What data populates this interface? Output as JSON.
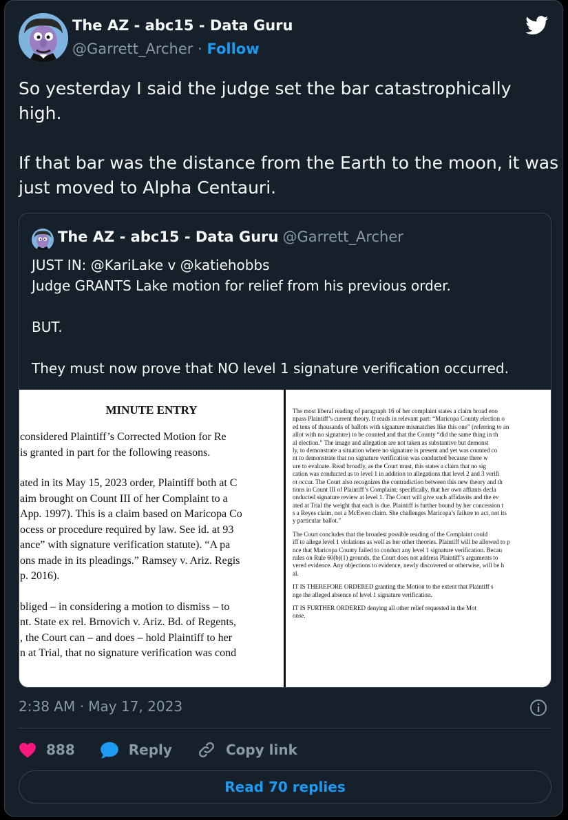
{
  "tweet": {
    "author_name": "The AZ - abc15 - Data Guru",
    "author_handle": "@Garrett_Archer",
    "separator": " · ",
    "follow_label": "Follow",
    "text": "So yesterday I said the judge set the bar catastrophically high.\n\nIf that bar was the distance from the Earth to the moon, it was just moved to Alpha Centauri.",
    "timestamp": "2:38 AM · May 17, 2023",
    "likes": "888",
    "reply_label": "Reply",
    "copy_link_label": "Copy link",
    "read_replies_label": "Read 70 replies"
  },
  "quoted": {
    "author_name": "The AZ - abc15 - Data Guru",
    "author_handle": "@Garrett_Archer",
    "text": "JUST IN: @KariLake v @katiehobbs\nJudge GRANTS Lake motion for relief from his previous order.\n\nBUT.\n\nThey must now prove that NO level 1 signature verification occurred."
  },
  "document_left": {
    "heading": "MINUTE ENTRY",
    "lines": [
      "considered Plaintiff’s Corrected Motion for Re",
      "is granted in part for the following reasons.",
      "",
      "ated in its May 15, 2023 order, Plaintiff both at C",
      "aim brought on Count III of her Complaint to a",
      "App. 1997). This is a claim based on Maricopa Co",
      "ocess or procedure required by law. See id. at 93",
      "ance” with signature verification statute). “A pa",
      "ons made in its pleadings.” Ramsey v. Ariz. Regis",
      "p. 2016).",
      "",
      "bliged – in considering a motion to dismiss – to",
      "nt. State ex rel. Brnovich v. Ariz. Bd. of Regents,",
      ", the Court can – and does – hold Plaintiff to her",
      "n at Trial, that no signature verification was cond"
    ]
  },
  "document_right": {
    "lines": [
      "The most liberal reading of paragraph 16 of her complaint states a claim broad eno",
      "npass Plaintiff’s current theory. It reads in relevant part: “Maricopa County election o",
      "ed tens of thousands of ballots with signature mismatches like this one” (referring to an",
      "allot with no signature) to be counted and that the County “did the same thing in th",
      "al election.” The image and allegation are not taken as substantive but demonst",
      "ly, to demonstrate a situation where no signature is present and yet was counted co",
      "nt to demonstrate that no signature verification was conducted because there w",
      "ure to evaluate. Read broadly, as the Court must, this states a claim that no sig",
      "cation was conducted as to level 1 in addition to allegations that level 2 and 3 verifi",
      "ot occur. The Court also recognizes the contradiction between this new theory and th",
      "tions in Count III of Plaintiff’s Complaint; specifically, that her own affiants decla",
      "onducted signature review at level 1. The Court will give such affidavits and the ev",
      "ated at Trial the weight that each is due. Plaintiff is further bound by her concession t",
      "s a Reyes claim, not a McEwen claim. She challenges Maricopa’s failure to act, not its",
      "y particular ballot.”",
      "",
      "The Court concludes that the broadest possible reading of the Complaint could",
      "iff to allege level 1 violations as well as her other theories. Plaintiff will be allowed to p",
      "nce that Maricopa County failed to conduct any level 1 signature verification. Becau",
      "rules on Rule 60(b)(1) grounds, the Court does not address Plaintiff’s arguments to",
      "vered evidence. Any objections to evidence, newly discovered or otherwise, will be h",
      "al.",
      "",
      "IT IS THEREFORE ORDERED granting the Motion to the extent that Plaintiff s",
      "nge the alleged absence of level 1 signature verification.",
      "",
      "IT IS FURTHER ORDERED denying all other relief requested in the Mot",
      "onse."
    ]
  },
  "colors": {
    "background": "#15202b",
    "border": "#38444d",
    "accent": "#1d9bf0",
    "like": "#f91880",
    "muted": "#8b98a5"
  },
  "icons": [
    "twitter-bird-icon",
    "info-icon",
    "heart-icon",
    "reply-bubble-icon",
    "link-icon"
  ]
}
